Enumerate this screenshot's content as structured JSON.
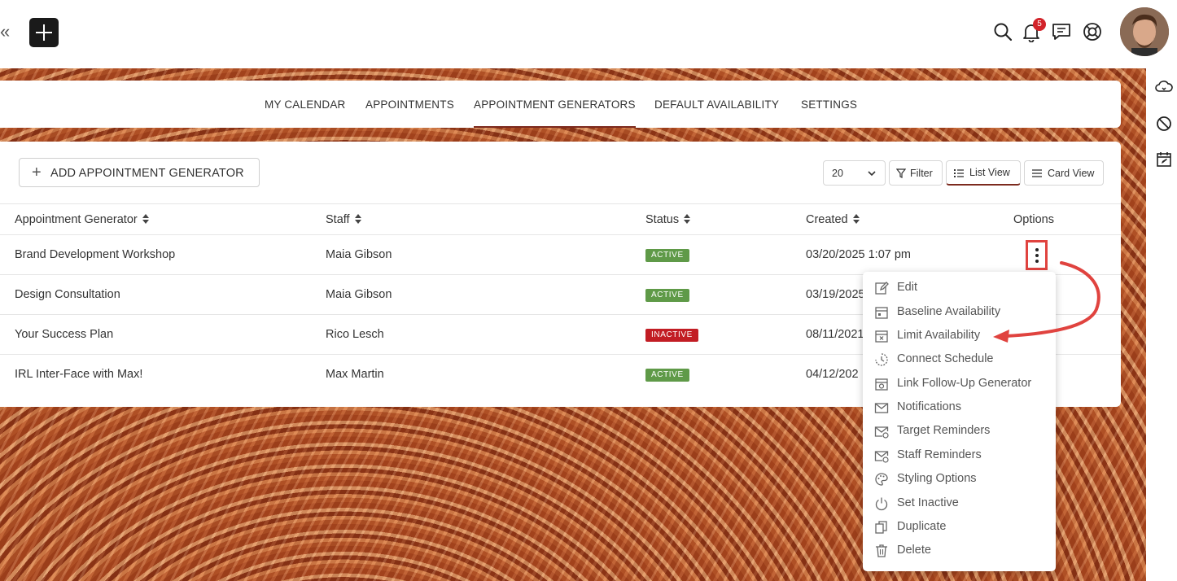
{
  "header": {
    "collapse_glyph": "«",
    "notification_count": "5",
    "icons": [
      "collapse-icon",
      "plus-icon",
      "search-icon",
      "bell-icon",
      "chat-icon",
      "lifebuoy-icon",
      "avatar"
    ]
  },
  "tabs": [
    {
      "label": "MY CALENDAR",
      "active": false
    },
    {
      "label": "APPOINTMENTS",
      "active": false
    },
    {
      "label": "APPOINTMENT GENERATORS",
      "active": true
    },
    {
      "label": "DEFAULT AVAILABILITY",
      "active": false
    },
    {
      "label": "SETTINGS",
      "active": false
    }
  ],
  "toolbar": {
    "add_label": "ADD APPOINTMENT GENERATOR",
    "page_size": "20",
    "filter_label": "Filter",
    "list_view_label": "List View",
    "card_view_label": "Card View"
  },
  "table": {
    "columns": [
      "Appointment Generator",
      "Staff",
      "Status",
      "Created",
      "Options"
    ],
    "rows": [
      {
        "name": "Brand Development Workshop",
        "staff": "Maia Gibson",
        "status": "ACTIVE",
        "created": "03/20/2025 1:07 pm"
      },
      {
        "name": "Design Consultation",
        "staff": "Maia Gibson",
        "status": "ACTIVE",
        "created": "03/19/2025"
      },
      {
        "name": "Your Success Plan",
        "staff": "Rico Lesch",
        "status": "INACTIVE",
        "created": "08/11/2021"
      },
      {
        "name": "IRL Inter-Face with Max!",
        "staff": "Max Martin",
        "status": "ACTIVE",
        "created": "04/12/202"
      }
    ]
  },
  "options_menu": [
    {
      "label": "Edit",
      "icon": "edit-icon"
    },
    {
      "label": "Baseline Availability",
      "icon": "calendar-icon"
    },
    {
      "label": "Limit Availability",
      "icon": "calendar-x-icon"
    },
    {
      "label": "Connect Schedule",
      "icon": "connect-icon"
    },
    {
      "label": "Link Follow-Up Generator",
      "icon": "calendar-link-icon"
    },
    {
      "label": "Notifications",
      "icon": "envelope-icon"
    },
    {
      "label": "Target Reminders",
      "icon": "envelope-clock-icon"
    },
    {
      "label": "Staff Reminders",
      "icon": "envelope-clock-icon"
    },
    {
      "label": "Styling Options",
      "icon": "palette-icon"
    },
    {
      "label": "Set Inactive",
      "icon": "power-icon"
    },
    {
      "label": "Duplicate",
      "icon": "duplicate-icon"
    },
    {
      "label": "Delete",
      "icon": "trash-icon"
    }
  ],
  "colors": {
    "accent": "#7c2a1e",
    "active_badge": "#5f9a48",
    "inactive_badge": "#c21d24",
    "highlight": "#e0433f"
  }
}
